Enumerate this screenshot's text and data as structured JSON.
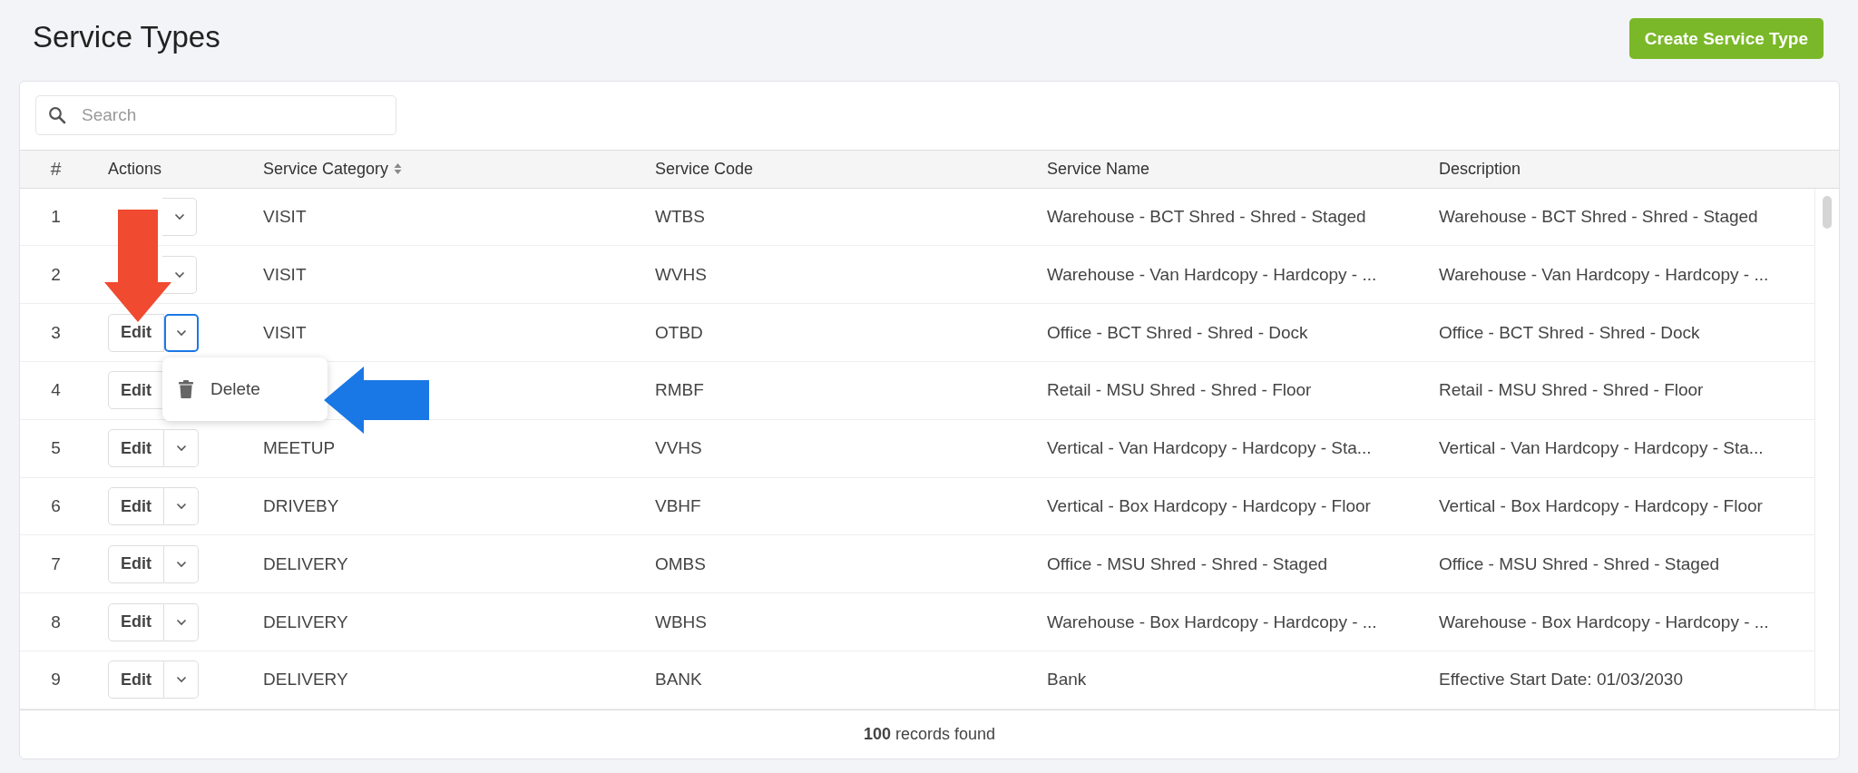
{
  "page": {
    "title": "Service Types",
    "create_button": "Create Service Type"
  },
  "search": {
    "placeholder": "Search"
  },
  "table": {
    "columns": [
      {
        "label": "#",
        "sortable": false
      },
      {
        "label": "Actions",
        "sortable": false
      },
      {
        "label": "Service Category",
        "sortable": true
      },
      {
        "label": "Service Code",
        "sortable": false
      },
      {
        "label": "Service Name",
        "sortable": false
      },
      {
        "label": "Description",
        "sortable": false
      }
    ],
    "rows": [
      {
        "number": "1",
        "category": "VISIT",
        "code": "WTBS",
        "name": "Warehouse - BCT Shred - Shred - Staged",
        "description": "Warehouse - BCT Shred - Shred - Staged",
        "menu_open": false
      },
      {
        "number": "2",
        "category": "VISIT",
        "code": "WVHS",
        "name": "Warehouse - Van Hardcopy - Hardcopy - ...",
        "description": "Warehouse - Van Hardcopy - Hardcopy - ...",
        "menu_open": false
      },
      {
        "number": "3",
        "edit": "Edit",
        "category": "VISIT",
        "code": "OTBD",
        "name": "Office - BCT Shred - Shred - Dock",
        "description": "Office - BCT Shred - Shred - Dock",
        "menu_open": true,
        "menu": [
          "Delete"
        ]
      },
      {
        "number": "4",
        "edit": "Edit",
        "code": "RMBF",
        "name": "Retail - MSU Shred - Shred - Floor",
        "description": "Retail - MSU Shred - Shred - Floor"
      },
      {
        "number": "5",
        "edit": "Edit",
        "category": "MEETUP",
        "code": "VVHS",
        "name": "Vertical - Van Hardcopy - Hardcopy - Sta...",
        "description": "Vertical - Van Hardcopy - Hardcopy - Sta...",
        "menu_open": false
      },
      {
        "number": "6",
        "edit": "Edit",
        "category": "DRIVEBY",
        "code": "VBHF",
        "name": "Vertical - Box Hardcopy - Hardcopy - Floor",
        "description": "Vertical - Box Hardcopy - Hardcopy - Floor",
        "menu_open": false
      },
      {
        "number": "7",
        "edit": "Edit",
        "category": "DELIVERY",
        "code": "OMBS",
        "name": "Office - MSU Shred - Shred - Staged",
        "description": "Office - MSU Shred - Shred - Staged",
        "menu_open": false
      },
      {
        "number": "8",
        "edit": "Edit",
        "category": "DELIVERY",
        "code": "WBHS",
        "name": "Warehouse - Box Hardcopy - Hardcopy - ...",
        "description": "Warehouse - Box Hardcopy - Hardcopy - ...",
        "menu_open": false
      },
      {
        "number": "9",
        "edit": "Edit",
        "category": "DELIVERY",
        "code": "BANK",
        "name": "Bank",
        "description": "Effective Start Date: 01/03/2030",
        "menu_open": false
      }
    ],
    "footer": "**100** records found"
  },
  "annotations": [
    {
      "kind": "down-arrow",
      "color": "#f04a30"
    },
    {
      "kind": "left-arrow",
      "color": "#1a78e6"
    }
  ]
}
